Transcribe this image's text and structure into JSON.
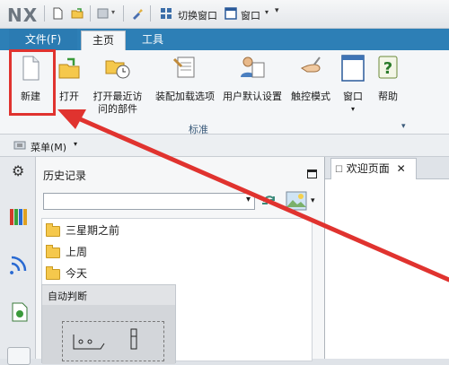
{
  "app": {
    "logo": "NX"
  },
  "quick_access": {
    "switch_window": "切换窗口",
    "window_menu": "窗口"
  },
  "tabs": {
    "file": "文件(F)",
    "home": "主页",
    "tools": "工具"
  },
  "ribbon": {
    "buttons": [
      {
        "label": "新建",
        "icon": "new-document-icon"
      },
      {
        "label": "打开",
        "icon": "open-folder-icon"
      },
      {
        "label": "打开最近访问的部件",
        "line1": "打开最近访",
        "line2": "问的部件",
        "icon": "recent-parts-icon"
      },
      {
        "label": "装配加载选项",
        "icon": "assembly-load-options-icon"
      },
      {
        "label": "用户默认设置",
        "icon": "user-defaults-icon"
      },
      {
        "label": "触控模式",
        "icon": "touch-mode-icon"
      },
      {
        "label": "窗口",
        "icon": "window-icon"
      },
      {
        "label": "帮助",
        "icon": "help-icon"
      }
    ],
    "group_label": "标准"
  },
  "menu": {
    "label": "菜单(M)"
  },
  "history_panel": {
    "title": "历史记录",
    "combo_value": "",
    "items": [
      "三星期之前",
      "上周",
      "今天"
    ],
    "auto_label": "自动判断"
  },
  "document_tabs": {
    "welcome": "欢迎页面"
  },
  "colors": {
    "ribbon_blue": "#2d7fb6",
    "highlight_red": "#e0332f",
    "folder_yellow": "#f5c84c"
  }
}
